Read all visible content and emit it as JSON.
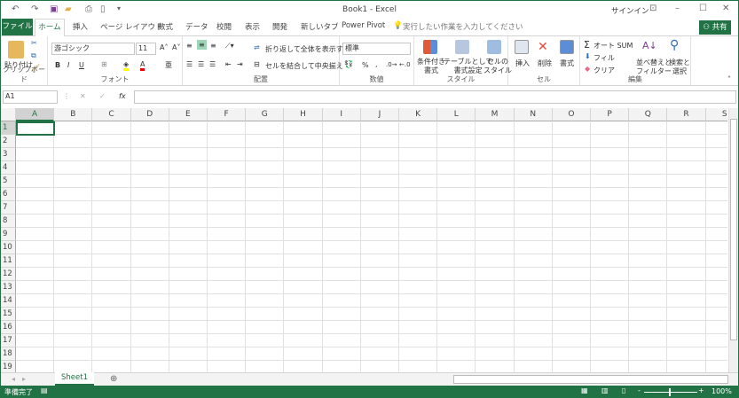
{
  "title": "Book1 - Excel",
  "quick_access": [
    "undo-icon",
    "redo-icon",
    "save-icon",
    "open-icon",
    "print-preview-icon",
    "new-icon",
    "customize-icon"
  ],
  "signin": "サインイン",
  "tabs": [
    "ファイル",
    "ホーム",
    "挿入",
    "ページ レイアウト",
    "数式",
    "データ",
    "校閲",
    "表示",
    "開発",
    "新しいタブ",
    "Power Pivot"
  ],
  "tell_me": "実行したい作業を入力してください",
  "share": "共有",
  "ribbon": {
    "clipboard": {
      "label": "クリップボード",
      "paste": "貼り付け"
    },
    "font": {
      "label": "フォント",
      "name": "游ゴシック",
      "size": "11",
      "bold": "B",
      "italic": "I",
      "underline": "U",
      "font_color": "A"
    },
    "alignment": {
      "label": "配置",
      "wrap": "折り返して全体を表示する",
      "merge": "セルを結合して中央揃え"
    },
    "number": {
      "label": "数値",
      "format": "標準",
      "percent": "%",
      "comma": ","
    },
    "styles": {
      "label": "スタイル",
      "conditional": [
        "条件付き",
        "書式"
      ],
      "table": [
        "テーブルとして",
        "書式設定"
      ],
      "cell": [
        "セルの",
        "スタイル"
      ]
    },
    "cells": {
      "label": "セル",
      "insert": "挿入",
      "delete": "削除",
      "format": "書式"
    },
    "editing": {
      "label": "編集",
      "autosum": "オート SUM",
      "fill": "フィル",
      "clear": "クリア",
      "sort": [
        "並べ替えと",
        "フィルター"
      ],
      "find": [
        "検索と",
        "選択"
      ]
    }
  },
  "name_box": "A1",
  "formula": "",
  "fx": "fx",
  "columns": [
    "A",
    "B",
    "C",
    "D",
    "E",
    "F",
    "G",
    "H",
    "I",
    "J",
    "K",
    "L",
    "M",
    "N",
    "O",
    "P",
    "Q",
    "R",
    "S"
  ],
  "rows": [
    "1",
    "2",
    "3",
    "4",
    "5",
    "6",
    "7",
    "8",
    "9",
    "10",
    "11",
    "12",
    "13",
    "14",
    "15",
    "16",
    "17",
    "18",
    "19"
  ],
  "sheets": [
    "Sheet1"
  ],
  "status": {
    "ready": "準備完了",
    "zoom": "100%",
    "zoom_level": 100
  },
  "accent": "#217346"
}
